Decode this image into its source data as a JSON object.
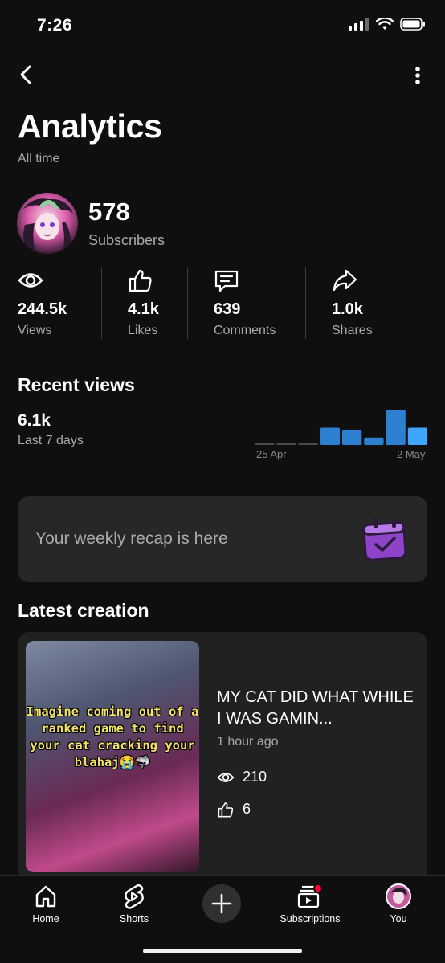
{
  "status": {
    "time": "7:26"
  },
  "header": {
    "title": "Analytics",
    "subtitle": "All time"
  },
  "channel": {
    "subscribers_value": "578",
    "subscribers_label": "Subscribers"
  },
  "stats": [
    {
      "icon": "eye-icon",
      "value": "244.5k",
      "label": "Views"
    },
    {
      "icon": "thumbs-up-icon",
      "value": "4.1k",
      "label": "Likes"
    },
    {
      "icon": "comment-icon",
      "value": "639",
      "label": "Comments"
    },
    {
      "icon": "share-icon",
      "value": "1.0k",
      "label": "Shares"
    }
  ],
  "recent_views": {
    "title": "Recent views",
    "value": "6.1k",
    "label": "Last 7 days",
    "chart_data": {
      "type": "bar",
      "categories": [
        "",
        "",
        "",
        "",
        "",
        "",
        "",
        ""
      ],
      "values": [
        2,
        2,
        2,
        21,
        18,
        9,
        43,
        21
      ],
      "x_ticks": [
        "25 Apr",
        "2 May"
      ],
      "color": "#3ea6ff"
    }
  },
  "recap": {
    "text": "Your weekly recap is here"
  },
  "latest": {
    "title": "Latest creation",
    "thumbnail_caption": "Imagine coming out of a ranked game to find your cat cracking your blahaj😭🦈",
    "video_title": "MY CAT DID WHAT WHILE I WAS GAMIN...",
    "time": "1 hour ago",
    "views": "210",
    "likes": "6"
  },
  "nav": {
    "home": "Home",
    "shorts": "Shorts",
    "subscriptions": "Subscriptions",
    "you": "You"
  }
}
